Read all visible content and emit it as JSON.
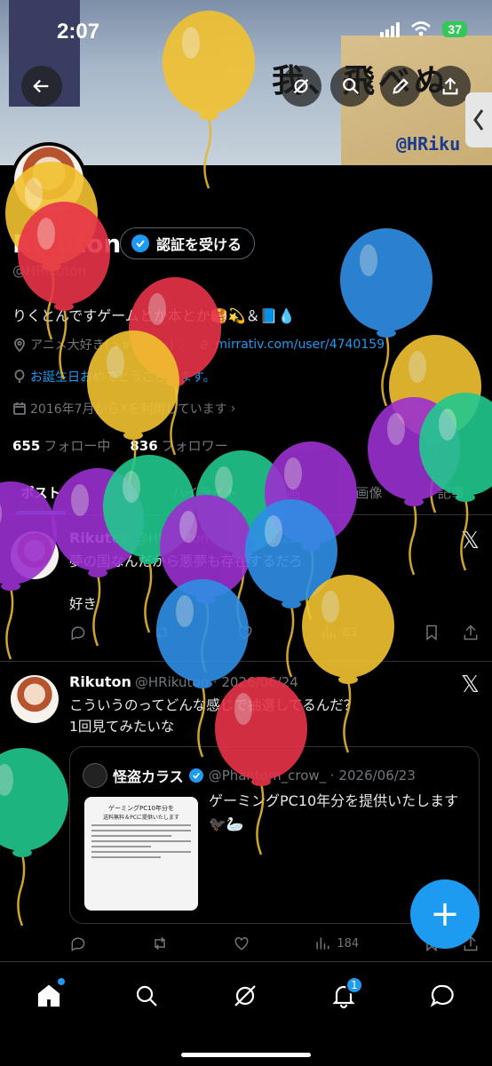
{
  "status": {
    "time": "2:07",
    "battery": "37"
  },
  "banner": {
    "title": "我、飛べぬ",
    "handle": "@HRiku"
  },
  "profile": {
    "name": "Rikuton",
    "handle": "@HRikuton",
    "verify_label": "認証を受ける",
    "bio": "りくとんですゲームとか本とか🥞💫＆📘💧",
    "location": "アニメ大好き(ゝ∀･)(･ω･)♡",
    "website": "mirrativ.com/user/4740159",
    "birthday": "お誕生日おめでとうございます。",
    "joined": "2016年7月からXを利用しています",
    "following_count": "655",
    "following_label": "フォロー中",
    "followers_count": "836",
    "followers_label": "フォロワー"
  },
  "tabs": [
    "ポスト",
    "返信",
    "ハイライト",
    "動画",
    "画像",
    "記事"
  ],
  "posts": [
    {
      "name": "Rikuton",
      "meta": "@HRikuton · 2026/06/25",
      "text1": "夢の国なんだから悪夢も存在するだろ",
      "text2": "好き",
      "views": "83"
    },
    {
      "name": "Rikuton",
      "meta": "@HRikuton · 2026/06/24",
      "text1": "こういうのってどんな感じで抽選してるんだ？",
      "text2": "1回見てみたいな",
      "views": "184",
      "quote": {
        "name": "怪盗カラス",
        "meta": "@Phantom_crow_ · 2026/06/23",
        "text": "ゲーミングPC10年分を提供いたします🐦‍⬛🦢",
        "image_title": "ゲーミングPC10年分を",
        "image_subtitle": "送料無料＆PCに提供いたします"
      }
    }
  ],
  "fab": "+",
  "nav": {
    "notifications_badge": "1"
  },
  "colors": {
    "accent": "#1d9bf0",
    "balloon_yellow": "#f2c230",
    "balloon_red": "#e8334a",
    "balloon_blue": "#2f8fe6",
    "balloon_green": "#22c88e",
    "balloon_purple": "#9b30d0"
  }
}
